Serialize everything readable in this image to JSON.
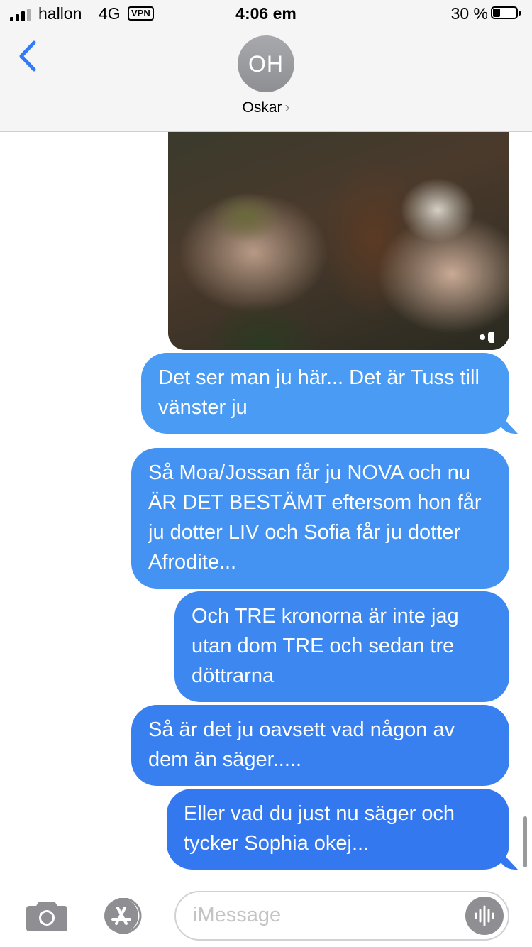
{
  "status_bar": {
    "carrier": "hallon",
    "network": "4G",
    "vpn": "VPN",
    "time": "4:06 em",
    "battery_percent": "30 %",
    "battery_level": 0.3
  },
  "header": {
    "avatar_initials": "OH",
    "contact_name": "Oskar",
    "back_icon": "chevron-left-icon",
    "accent_color": "#2f7cf6"
  },
  "messages": [
    {
      "type": "image",
      "from": "me"
    },
    {
      "type": "text",
      "from": "me",
      "text": "Det ser man ju här... Det är Tuss till vänster ju"
    },
    {
      "type": "text",
      "from": "me",
      "text": "Så Moa/Jossan får ju NOVA och nu ÄR DET BESTÄMT eftersom hon får ju dotter LIV och Sofia får ju dotter Afrodite..."
    },
    {
      "type": "text",
      "from": "me",
      "text": "Och TRE kronorna är inte jag utan dom TRE och sedan tre döttrarna"
    },
    {
      "type": "text",
      "from": "me",
      "text": "Så är det ju oavsett vad någon av dem än säger....."
    },
    {
      "type": "text",
      "from": "me",
      "text": "Eller vad du just nu säger och tycker Sophia okej..."
    }
  ],
  "composer": {
    "placeholder": "iMessage",
    "camera_icon": "camera-icon",
    "apps_icon": "app-store-icon",
    "audio_icon": "audio-waveform-icon"
  }
}
